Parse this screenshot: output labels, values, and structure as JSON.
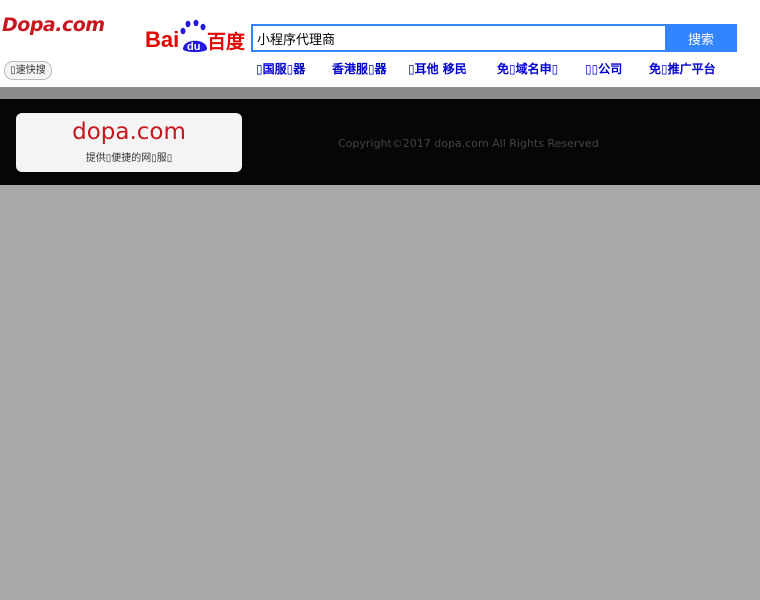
{
  "header": {
    "logo_text": "Dopa.com",
    "quick_button": "▯速快搜",
    "baidu_logo": {
      "bai": "Bai",
      "du": "du",
      "cn": "百度"
    }
  },
  "search": {
    "value": "小程序代理商",
    "button_label": "搜索"
  },
  "nav": {
    "items": [
      {
        "label": "▯国服▯器"
      },
      {
        "label": "香港服▯器"
      },
      {
        "label": "▯耳他 移民"
      },
      {
        "label": "免▯域名申▯"
      },
      {
        "label": "▯▯公司"
      },
      {
        "label": "免▯推广平台"
      }
    ]
  },
  "footer": {
    "card_title": "dopa.com",
    "card_subtitle": "提供▯便捷的网▯服▯",
    "copyright": "Copyright©2017  dopa.com  All Rights Reserved"
  },
  "colors": {
    "brand_red": "#c8161e",
    "baidu_blue": "#3385ff",
    "nav_blue": "#0000cc",
    "footer_bg": "#060606",
    "page_gray": "#a9a9a9"
  }
}
